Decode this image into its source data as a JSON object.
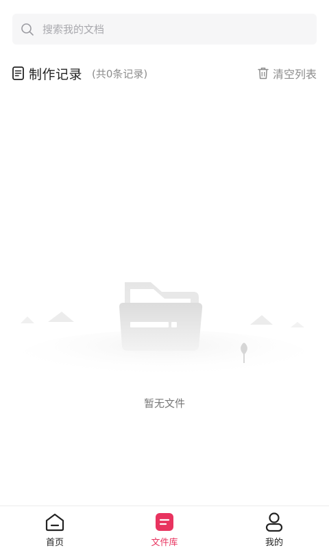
{
  "search": {
    "placeholder": "搜索我的文档",
    "value": ""
  },
  "records": {
    "title": "制作记录",
    "count_text": "(共0条记录)",
    "clear_label": "清空列表"
  },
  "empty_state": {
    "text": "暂无文件"
  },
  "nav": {
    "items": [
      {
        "label": "首页",
        "icon": "home-icon",
        "active": false
      },
      {
        "label": "文件库",
        "icon": "file-library-icon",
        "active": true
      },
      {
        "label": "我的",
        "icon": "profile-icon",
        "active": false
      }
    ]
  },
  "colors": {
    "accent": "#e8335f",
    "text_primary": "#222222",
    "text_secondary": "#8c8c8c",
    "search_bg": "#f6f6f7"
  }
}
